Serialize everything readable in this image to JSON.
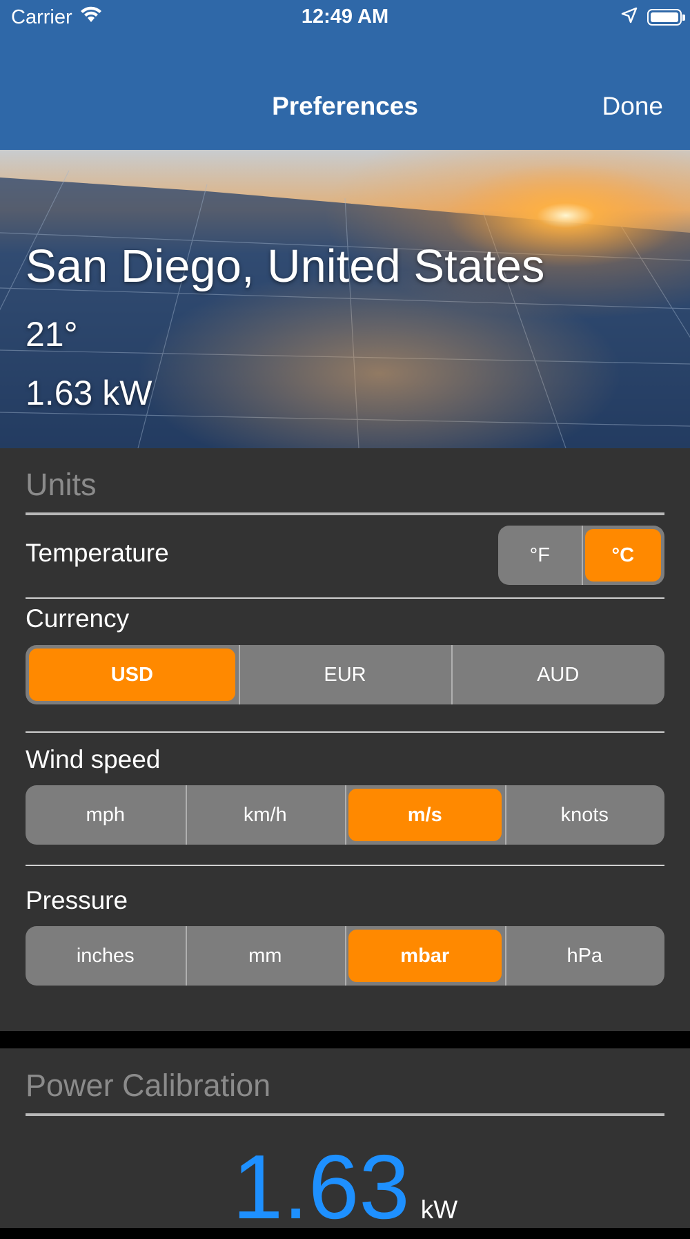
{
  "status_bar": {
    "carrier": "Carrier",
    "time": "12:49 AM",
    "icons": [
      "wifi-icon",
      "location-arrow-icon",
      "battery-icon"
    ]
  },
  "nav": {
    "title": "Preferences",
    "done_label": "Done",
    "background_color": "#2f68a8"
  },
  "hero": {
    "city": "San Diego, United States",
    "temperature": "21°",
    "power": "1.63 kW"
  },
  "units": {
    "section_title": "Units",
    "temperature": {
      "label": "Temperature",
      "options": [
        "°F",
        "°C"
      ],
      "selected": "°C"
    },
    "currency": {
      "label": "Currency",
      "options": [
        "USD",
        "EUR",
        "AUD"
      ],
      "selected": "USD"
    },
    "wind_speed": {
      "label": "Wind speed",
      "options": [
        "mph",
        "km/h",
        "m/s",
        "knots"
      ],
      "selected": "m/s"
    },
    "pressure": {
      "label": "Pressure",
      "options": [
        "inches",
        "mm",
        "mbar",
        "hPa"
      ],
      "selected": "mbar"
    }
  },
  "power_calibration": {
    "section_title": "Power Calibration",
    "value": "1.63",
    "unit": "kW"
  },
  "colors": {
    "accent": "#ff8900",
    "value_blue": "#1e90ff",
    "panel": "#333333"
  }
}
